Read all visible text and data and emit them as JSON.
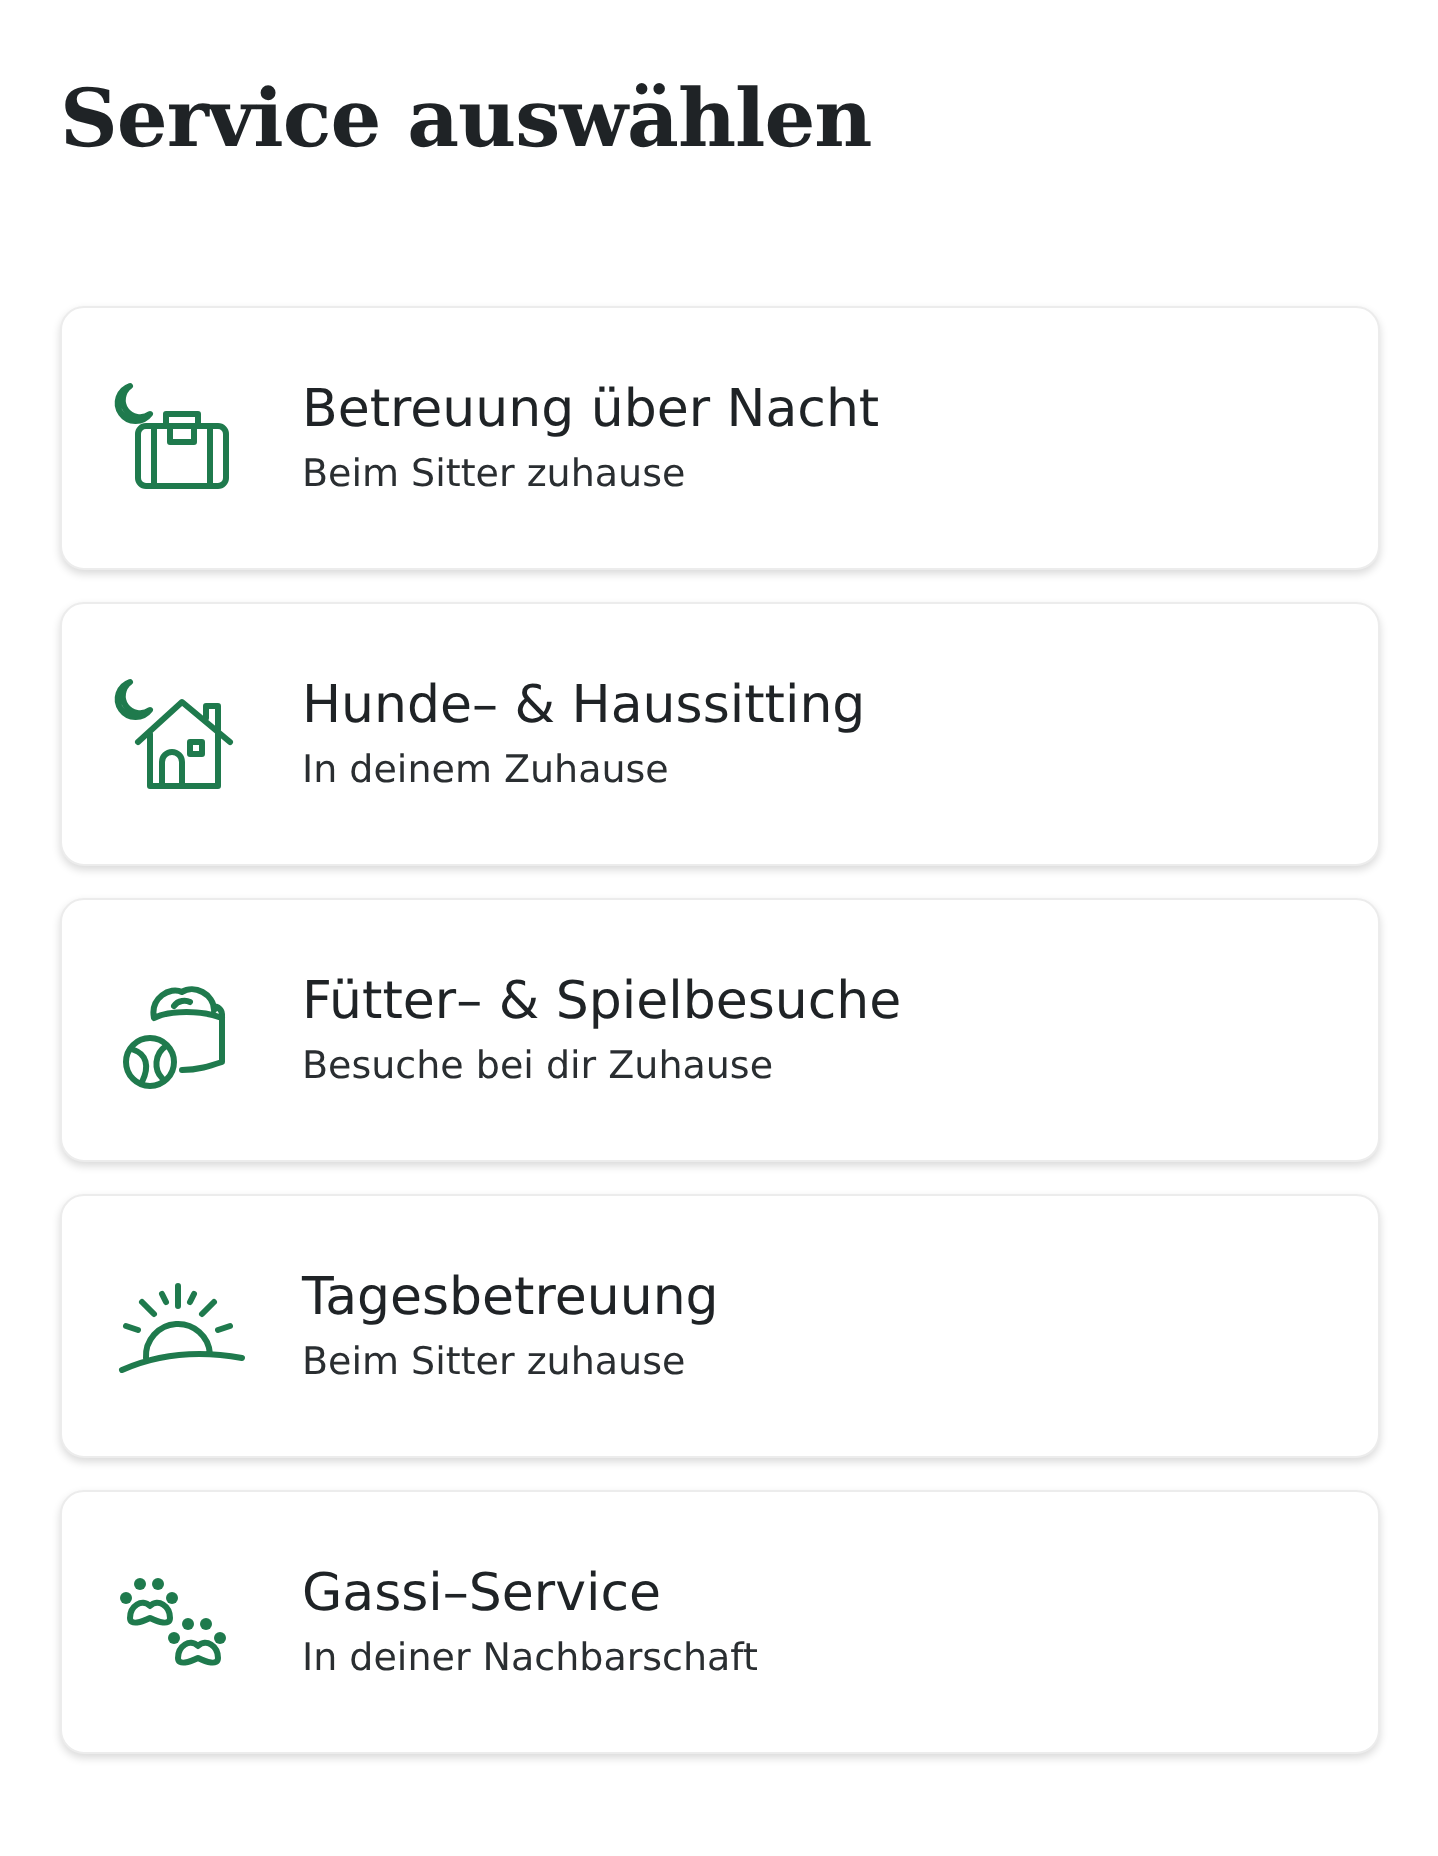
{
  "title": "Service auswählen",
  "services": [
    {
      "kind": "overnight",
      "name": "Betreuung über Nacht",
      "subtitle": "Beim Sitter zuhause"
    },
    {
      "kind": "house",
      "name": "Hunde– & Haussitting",
      "subtitle": "In deinem Zuhause"
    },
    {
      "kind": "feeding",
      "name": "Fütter– & Spielbesuche",
      "subtitle": "Besuche bei dir Zuhause"
    },
    {
      "kind": "daycare",
      "name": "Tagesbetreuung",
      "subtitle": "Beim Sitter zuhause"
    },
    {
      "kind": "walking",
      "name": "Gassi–Service",
      "subtitle": "In deiner Nachbarschaft"
    }
  ]
}
